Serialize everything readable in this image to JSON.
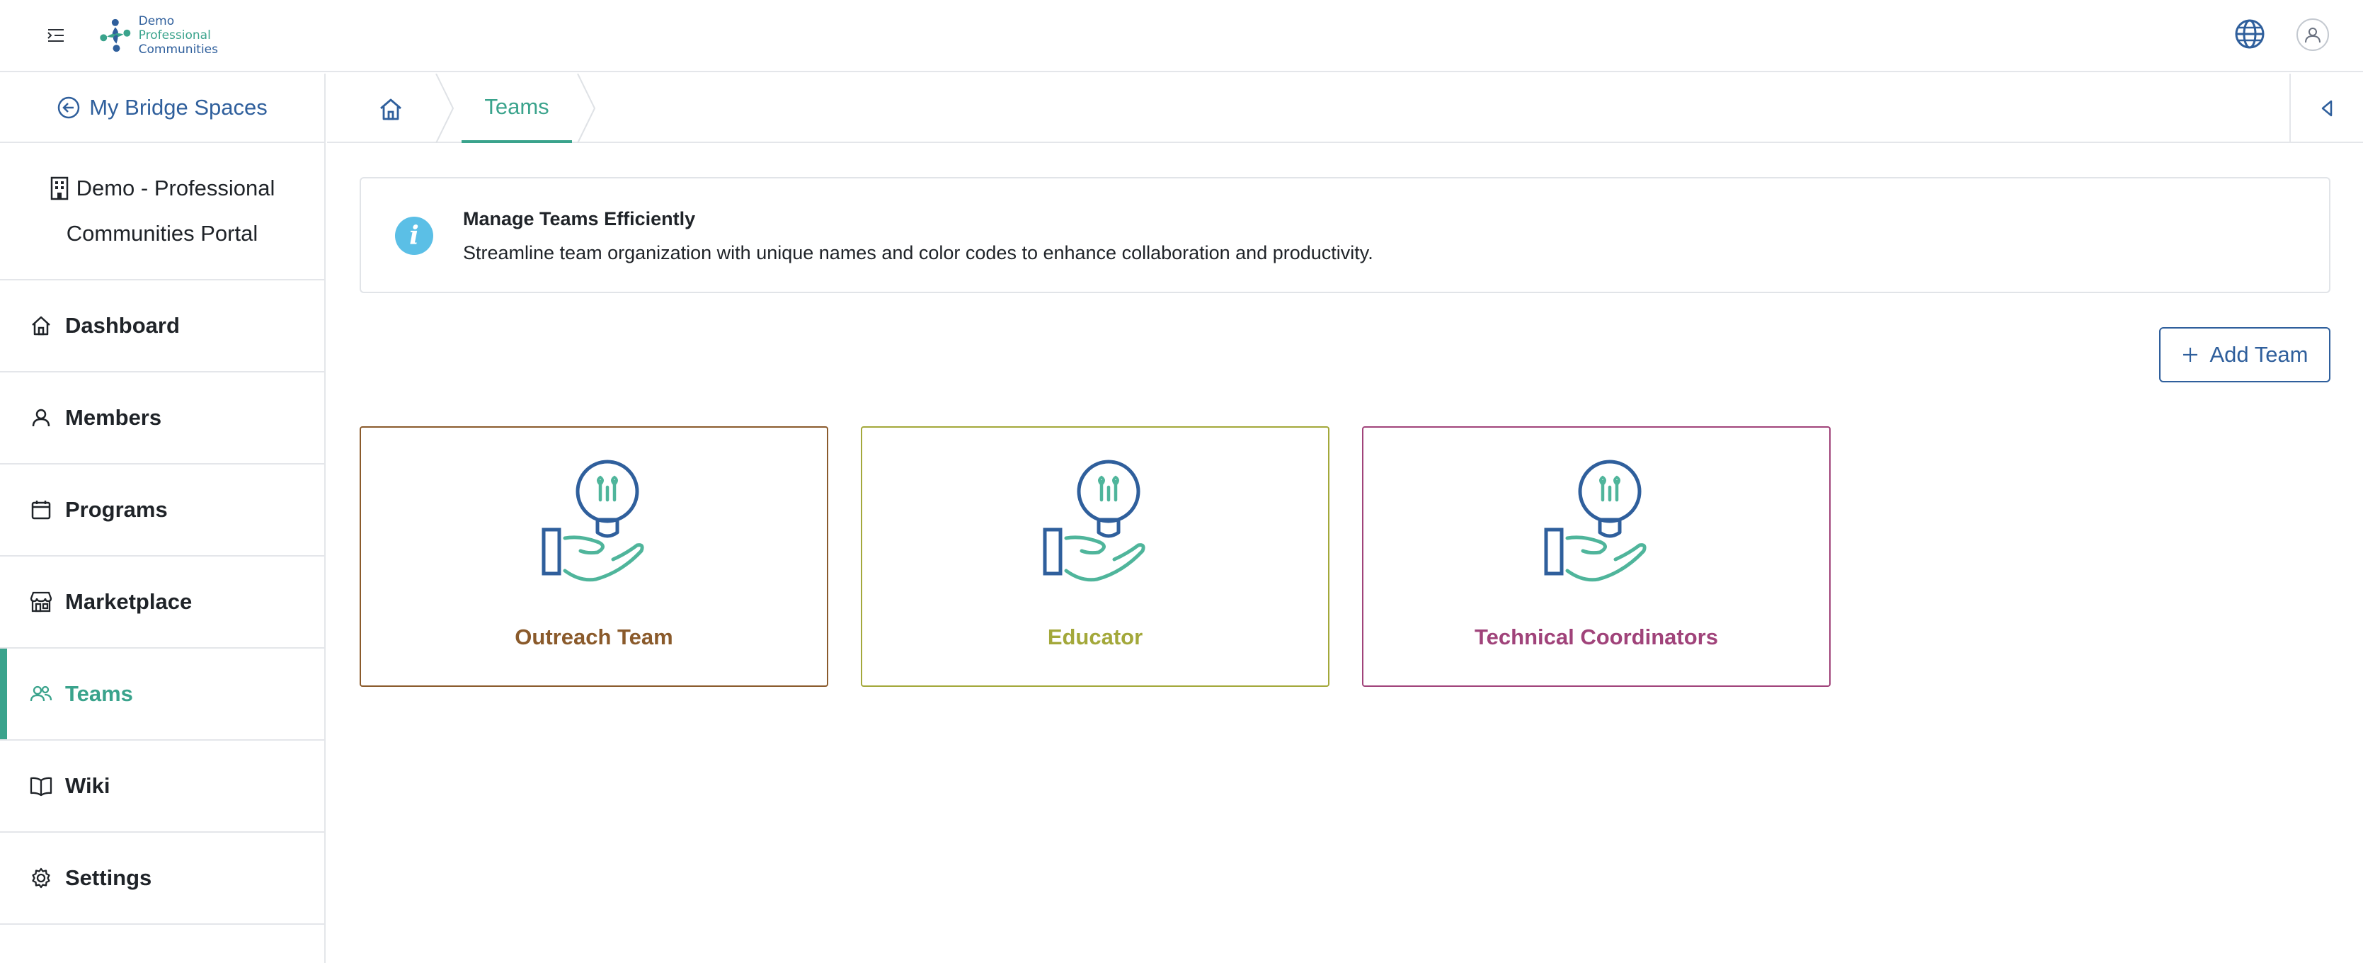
{
  "header": {
    "logo_lines": [
      "Demo",
      "Professional",
      "Communities"
    ],
    "icons": [
      "menu-toggle-icon",
      "globe-icon",
      "user-icon"
    ]
  },
  "sidebar": {
    "back_label": "My Bridge Spaces",
    "org_name_line1": "Demo - Professional",
    "org_name_line2": "Communities Portal",
    "items": [
      {
        "label": "Dashboard",
        "icon": "home-icon"
      },
      {
        "label": "Members",
        "icon": "user-icon"
      },
      {
        "label": "Programs",
        "icon": "calendar-icon"
      },
      {
        "label": "Marketplace",
        "icon": "store-icon"
      },
      {
        "label": "Teams",
        "icon": "team-icon",
        "active": true
      },
      {
        "label": "Wiki",
        "icon": "book-icon"
      },
      {
        "label": "Settings",
        "icon": "gear-icon"
      }
    ]
  },
  "breadcrumb": {
    "current": "Teams"
  },
  "banner": {
    "title": "Manage Teams Efficiently",
    "text": "Streamline team organization with unique names and color codes to enhance collaboration and productivity."
  },
  "add_team_label": "Add Team",
  "teams": [
    {
      "name": "Outreach Team",
      "color": "#8a5a2b"
    },
    {
      "name": "Educator",
      "color": "#a3a83a"
    },
    {
      "name": "Technical Coordinators",
      "color": "#a0437a"
    }
  ],
  "colors": {
    "accent": "#3aa38c",
    "primary": "#2f5f9c",
    "info": "#5bbfe6"
  }
}
